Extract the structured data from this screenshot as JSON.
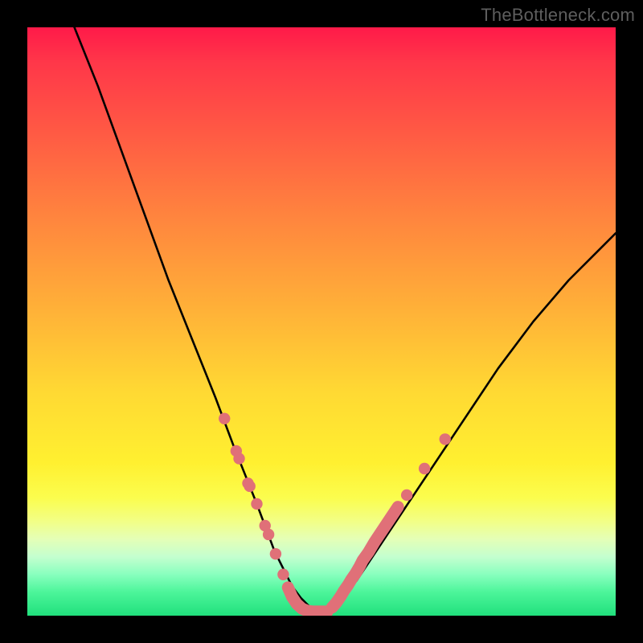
{
  "watermark": "TheBottleneck.com",
  "chart_data": {
    "type": "line",
    "title": "",
    "xlabel": "",
    "ylabel": "",
    "xlim": [
      0,
      100
    ],
    "ylim": [
      0,
      100
    ],
    "series": [
      {
        "name": "curve",
        "x": [
          8,
          12,
          16,
          20,
          24,
          28,
          32,
          35,
          37,
          39,
          40.5,
          42,
          43.5,
          45,
          46.5,
          48,
          49.5,
          51,
          56,
          62,
          68,
          74,
          80,
          86,
          92,
          98,
          100
        ],
        "y": [
          100,
          90,
          79,
          68,
          57,
          47,
          37,
          29,
          24,
          19,
          15,
          11,
          8,
          5,
          3,
          1.5,
          0.8,
          0.7,
          6,
          15,
          24,
          33,
          42,
          50,
          57,
          63,
          65
        ]
      }
    ],
    "markers": {
      "left_cluster": [
        {
          "x": 33.5,
          "y": 33.5
        },
        {
          "x": 35.5,
          "y": 28.0
        },
        {
          "x": 36.0,
          "y": 26.7
        },
        {
          "x": 37.5,
          "y": 22.5
        },
        {
          "x": 37.8,
          "y": 22.0
        },
        {
          "x": 39.0,
          "y": 19.0
        },
        {
          "x": 40.4,
          "y": 15.3
        },
        {
          "x": 41.0,
          "y": 13.8
        },
        {
          "x": 42.2,
          "y": 10.5
        },
        {
          "x": 43.5,
          "y": 7.0
        }
      ],
      "bottom_run": [
        {
          "x": 44.3,
          "y": 4.8
        },
        {
          "x": 45.0,
          "y": 3.2
        },
        {
          "x": 45.8,
          "y": 2.0
        },
        {
          "x": 46.7,
          "y": 1.2
        },
        {
          "x": 47.6,
          "y": 0.8
        },
        {
          "x": 48.5,
          "y": 0.7
        },
        {
          "x": 49.4,
          "y": 0.7
        },
        {
          "x": 50.3,
          "y": 0.7
        },
        {
          "x": 51.0,
          "y": 0.7
        }
      ],
      "right_cluster": [
        {
          "x": 51.8,
          "y": 1.4
        },
        {
          "x": 52.5,
          "y": 2.2
        },
        {
          "x": 53.2,
          "y": 3.2
        },
        {
          "x": 53.8,
          "y": 4.2
        },
        {
          "x": 54.5,
          "y": 5.2
        },
        {
          "x": 55.1,
          "y": 6.2
        },
        {
          "x": 55.8,
          "y": 7.2
        },
        {
          "x": 56.5,
          "y": 8.4
        },
        {
          "x": 57.0,
          "y": 9.4
        },
        {
          "x": 58.0,
          "y": 10.8
        },
        {
          "x": 59.0,
          "y": 12.5
        },
        {
          "x": 60.0,
          "y": 14.0
        },
        {
          "x": 61.0,
          "y": 15.5
        },
        {
          "x": 62.0,
          "y": 17.0
        },
        {
          "x": 63.0,
          "y": 18.5
        },
        {
          "x": 64.5,
          "y": 20.5
        },
        {
          "x": 67.5,
          "y": 25.0
        },
        {
          "x": 71.0,
          "y": 30.0
        }
      ]
    },
    "colors": {
      "curve": "#000000",
      "marker": "#e07078"
    }
  }
}
